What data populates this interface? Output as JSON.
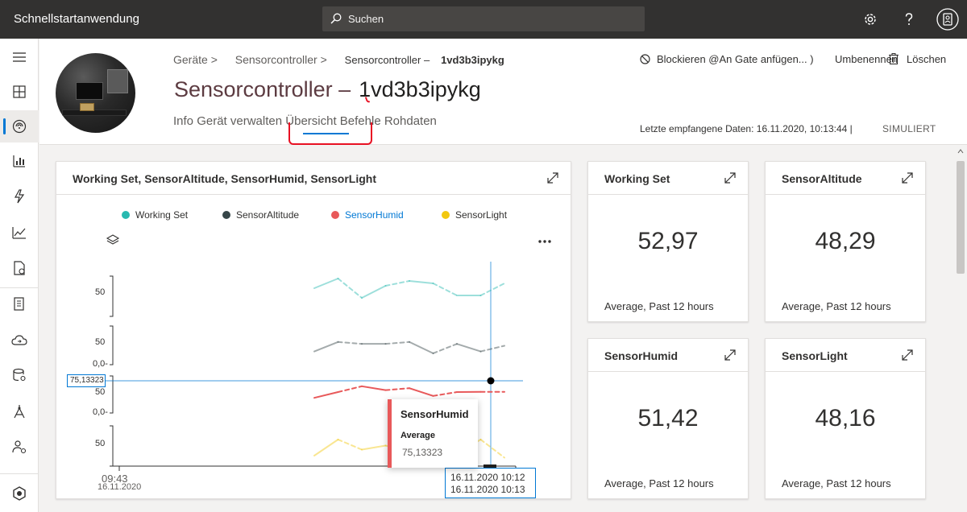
{
  "app": {
    "title": "Schnellstartanwendung"
  },
  "search": {
    "placeholder": "Suchen"
  },
  "topbar_icons": [
    "gear-icon",
    "help-icon",
    "account-icon"
  ],
  "sidebar": {
    "items": [
      {
        "icon": "hamburger-icon"
      },
      {
        "icon": "dashboard-icon"
      },
      {
        "icon": "devices-icon",
        "active": true
      },
      {
        "icon": "device-groups-icon"
      },
      {
        "icon": "rules-icon"
      },
      {
        "icon": "analytics-icon"
      },
      {
        "icon": "jobs-icon"
      },
      {
        "icon": "device-templates-icon"
      },
      {
        "icon": "data-export-icon"
      },
      {
        "icon": "device-connection-icon"
      },
      {
        "icon": "administration-icon"
      },
      {
        "icon": "permissions-icon"
      },
      {
        "icon": "iot-central-icon"
      }
    ]
  },
  "breadcrumb": {
    "items": [
      "Geräte >",
      "Sensorcontroller >",
      "Sensorcontroller –"
    ],
    "current": "1vd3b3ipykg"
  },
  "page": {
    "title": "Sensorcontroller –",
    "id": "1vd3b3ipykg"
  },
  "tabs": [
    "Info",
    "Gerät verwalten",
    "Übersicht",
    "Befehle",
    "Rohdaten"
  ],
  "actions": {
    "block": "Blockieren @An Gate anfügen... )",
    "rename": "Umbenennen",
    "delete": "Löschen"
  },
  "status": {
    "last_data": "Letzte empfangene Daten: 16.11.2020, 10:13:44 |",
    "simulated": "SIMULIERT"
  },
  "colors": {
    "working_set": "#28b9b0",
    "altitude": "#374649",
    "humid": "#e8595a",
    "light": "#f2c80f",
    "accent": "#0078d4"
  },
  "chart_card": {
    "title": "Working Set, SensorAltitude, SensorHumid, SensorLight",
    "legend": [
      "Working Set",
      "SensorAltitude",
      "SensorHumid",
      "SensorLight"
    ],
    "y_labels": [
      "50",
      "50",
      "0,0-",
      "50",
      "0,0-",
      "50"
    ],
    "y_hover_value": "75,13323",
    "x_start": "09:43",
    "x_start_date": "16.11.2020",
    "x_hover_1": "16.11.2020 10:12",
    "x_hover_2": "16.11.2020 10:13",
    "tooltip": {
      "title": "SensorHumid",
      "aggregation": "Average",
      "value": "75,13323"
    }
  },
  "chart_data": {
    "type": "line",
    "x": [
      "09:43",
      "10:12",
      "10:13"
    ],
    "title": "Working Set, SensorAltitude, SensorHumid, SensorLight",
    "series": [
      {
        "name": "Working Set",
        "values": [
          51,
          55,
          47,
          52,
          54,
          53,
          48,
          48,
          53
        ]
      },
      {
        "name": "SensorAltitude",
        "values": [
          47,
          52,
          51,
          51,
          52,
          46,
          51,
          47,
          50
        ]
      },
      {
        "name": "SensorHumid",
        "values": [
          72,
          75,
          78,
          76,
          77,
          73,
          75,
          75.13,
          75.13
        ]
      },
      {
        "name": "SensorLight",
        "values": [
          44,
          52,
          47,
          49,
          46,
          48,
          45,
          52,
          43
        ]
      }
    ]
  },
  "kpis": [
    {
      "title": "Working Set",
      "value": "52,97",
      "sub": "Average, Past 12 hours"
    },
    {
      "title": "SensorAltitude",
      "value": "48,29",
      "sub": "Average, Past 12 hours"
    },
    {
      "title": "SensorHumid",
      "value": "51,42",
      "sub": "Average, Past 12 hours"
    },
    {
      "title": "SensorLight",
      "value": "48,16",
      "sub": "Average, Past 12 hours"
    }
  ]
}
